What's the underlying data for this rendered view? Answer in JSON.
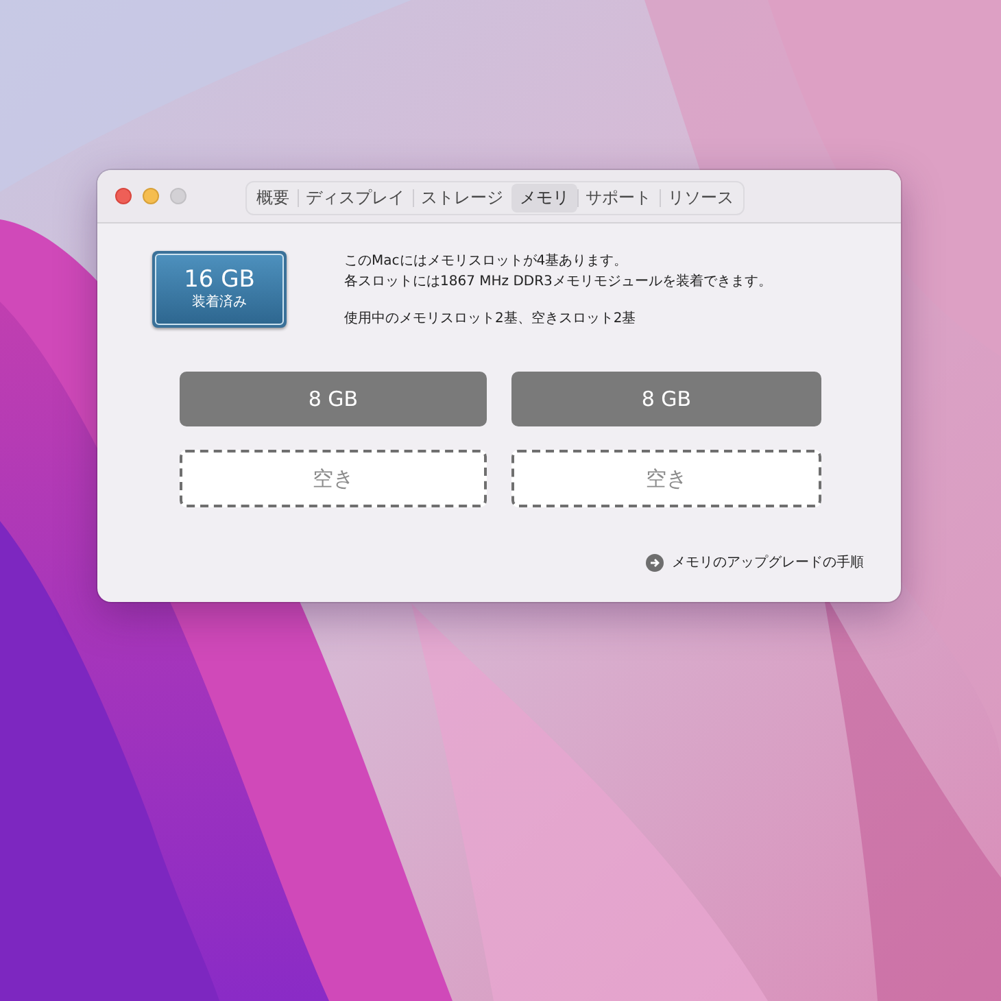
{
  "window": {
    "controls": [
      {
        "kind": "close",
        "disabled": false
      },
      {
        "kind": "minimize",
        "disabled": false
      },
      {
        "kind": "zoom",
        "disabled": true
      }
    ]
  },
  "tabs": [
    {
      "label": "概要",
      "selected": false
    },
    {
      "label": "ディスプレイ",
      "selected": false
    },
    {
      "label": "ストレージ",
      "selected": false
    },
    {
      "label": "メモリ",
      "selected": true
    },
    {
      "label": "サポート",
      "selected": false
    },
    {
      "label": "リソース",
      "selected": false
    }
  ],
  "memory_badge": {
    "size": "16 GB",
    "caption": "装着済み"
  },
  "description": [
    "このMacにはメモリスロットが4基あります。",
    "各スロットには1867 MHz DDR3メモリモジュールを装着できます。"
  ],
  "usage": "使用中のメモリスロット2基、空きスロット2基",
  "slots": [
    {
      "kind": "installed",
      "label": "8 GB"
    },
    {
      "kind": "installed",
      "label": "8 GB"
    },
    {
      "kind": "empty",
      "label": "空き"
    },
    {
      "kind": "empty",
      "label": "空き"
    }
  ],
  "upgrade_link": "メモリのアップグレードの手順"
}
